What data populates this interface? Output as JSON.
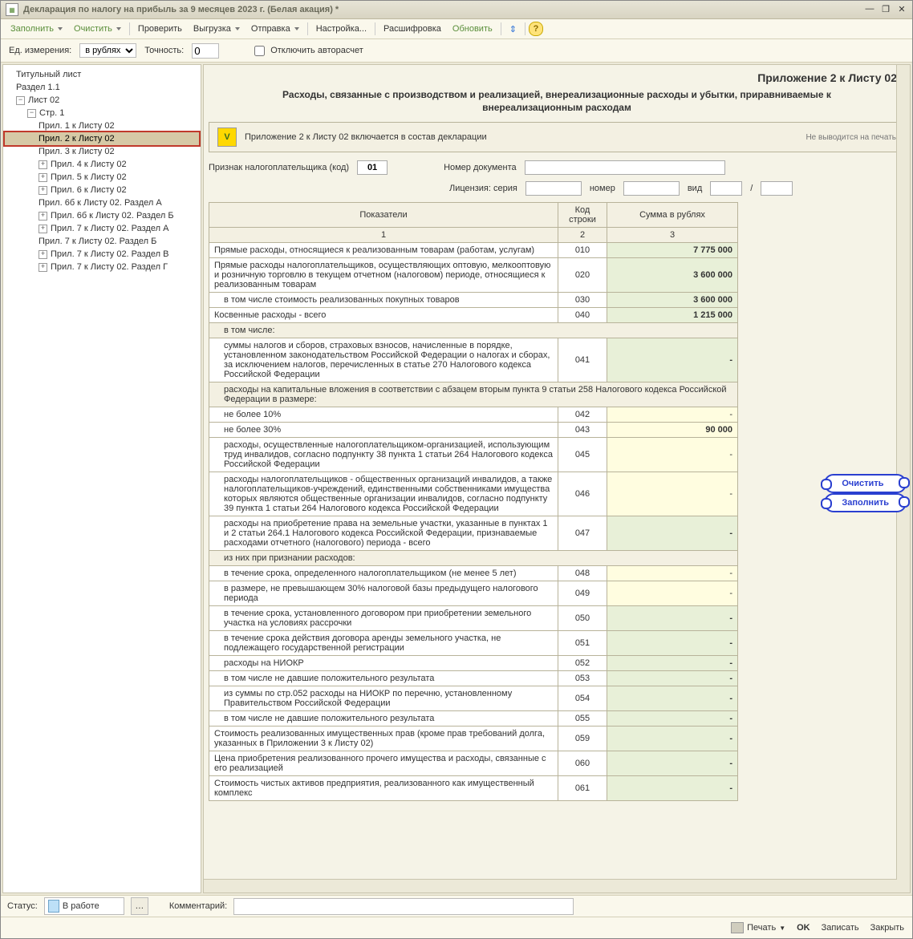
{
  "title": "Декларация по налогу на прибыль за 9 месяцев 2023 г. (Белая акация) *",
  "toolbar": {
    "fill": "Заполнить",
    "clear": "Очистить",
    "check": "Проверить",
    "upload": "Выгрузка",
    "send": "Отправка",
    "setup": "Настройка...",
    "decode": "Расшифровка",
    "refresh": "Обновить"
  },
  "opts": {
    "unit_label": "Ед. измерения:",
    "unit_value": "в рублях",
    "precision_label": "Точность:",
    "precision_value": "0",
    "autocalc": "Отключить авторасчет"
  },
  "tree": {
    "t1": "Титульный лист",
    "t2": "Раздел 1.1",
    "t3": "Лист 02",
    "t4": "Стр. 1",
    "i1": "Прил. 1 к Листу 02",
    "i2": "Прил. 2 к Листу 02",
    "i3": "Прил. 3 к Листу 02",
    "i4": "Прил. 4 к Листу 02",
    "i5": "Прил. 5 к Листу 02",
    "i6": "Прил. 6 к Листу 02",
    "i7": "Прил. 6б к Листу 02. Раздел А",
    "i8": "Прил. 6б к Листу 02. Раздел Б",
    "i9": "Прил. 7 к Листу 02. Раздел А",
    "i10": "Прил. 7 к Листу 02. Раздел Б",
    "i11": "Прил. 7 к Листу 02. Раздел В",
    "i12": "Прил. 7 к Листу 02. Раздел Г"
  },
  "page": {
    "title": "Приложение 2 к Листу 02",
    "subtitle": "Расходы, связанные с производством и реализацией, внереализационные расходы и убытки, приравниваемые к внереализационным расходам",
    "include_label": "Приложение 2 к Листу 02 включается в состав декларации",
    "noprint": "Не выводится на печать",
    "taxpayer_code_label": "Признак налогоплательщика (код)",
    "taxpayer_code": "01",
    "docnum_label": "Номер документа",
    "license_label": "Лицензия:  серия",
    "num_label": "номер",
    "type_label": "вид",
    "slash": "/"
  },
  "table": {
    "h1": "Показатели",
    "h2": "Код строки",
    "h3": "Сумма в рублях",
    "c1": "1",
    "c2": "2",
    "c3": "3",
    "rows": [
      {
        "t": "Прямые расходы, относящиеся к реализованным товарам (работам, услугам)",
        "c": "010",
        "s": "7 775 000",
        "cls": ""
      },
      {
        "t": "Прямые расходы налогоплательщиков, осуществляющих оптовую, мелкооптовую и розничную торговлю в текущем отчетном (налоговом) периоде, относящиеся к реализованным товарам",
        "c": "020",
        "s": "3 600 000",
        "cls": ""
      },
      {
        "t": "в том числе стоимость реализованных покупных товаров",
        "c": "030",
        "s": "3 600 000",
        "cls": "ind"
      },
      {
        "t": "Косвенные расходы - всего",
        "c": "040",
        "s": "1 215 000",
        "cls": ""
      },
      {
        "t": "в том числе:",
        "c": "",
        "s": "",
        "cls": "ind",
        "plain": true
      },
      {
        "t": "суммы налогов и сборов, страховых взносов, начисленные в порядке, установленном законодательством Российской Федерации о налогах и сборах, за исключением налогов, перечисленных в статье 270 Налогового кодекса Российской Федерации",
        "c": "041",
        "s": "-",
        "cls": "ind"
      },
      {
        "t": "расходы на капитальные вложения в соответствии с абзацем вторым пункта 9 статьи 258 Налогового кодекса Российской Федерации в размере:",
        "c": "",
        "s": "",
        "cls": "ind",
        "plain": true
      },
      {
        "t": "не более 10%",
        "c": "042",
        "s": "-",
        "cls": "ind",
        "yellow": true
      },
      {
        "t": "не более 30%",
        "c": "043",
        "s": "90 000",
        "cls": "ind",
        "yellow": true,
        "bold": true
      },
      {
        "t": "расходы, осуществленные налогоплательщиком-организацией, использующим труд инвалидов, согласно подпункту 38 пункта 1 статьи 264 Налогового кодекса Российской Федерации",
        "c": "045",
        "s": "-",
        "cls": "ind",
        "yellow": true
      },
      {
        "t": "расходы налогоплательщиков - общественных организаций инвалидов, а также налогоплательщиков-учреждений, единственными собственниками имущества которых являются общественные организации инвалидов, согласно подпункту 39 пункта 1 статьи 264 Налогового кодекса Российской Федерации",
        "c": "046",
        "s": "-",
        "cls": "ind",
        "yellow": true
      },
      {
        "t": "расходы на приобретение права на земельные участки, указанные в пунктах 1 и 2 статьи 264.1 Налогового кодекса Российской Федерации, признаваемые расходами отчетного (налогового) периода - всего",
        "c": "047",
        "s": "-",
        "cls": "ind"
      },
      {
        "t": "из них при признании расходов:",
        "c": "",
        "s": "",
        "cls": "ind",
        "plain": true
      },
      {
        "t": "в течение срока, определенного налогоплательщиком (не менее 5 лет)",
        "c": "048",
        "s": "-",
        "cls": "ind",
        "yellow": true
      },
      {
        "t": "в размере, не превышающем 30% налоговой базы предыдущего налогового периода",
        "c": "049",
        "s": "-",
        "cls": "ind",
        "yellow": true
      },
      {
        "t": "в течение срока, установленного договором при приобретении земельного участка на условиях рассрочки",
        "c": "050",
        "s": "-",
        "cls": "ind"
      },
      {
        "t": "в течение срока действия договора аренды земельного участка, не подлежащего государственной регистрации",
        "c": "051",
        "s": "-",
        "cls": "ind"
      },
      {
        "t": "расходы на НИОКР",
        "c": "052",
        "s": "-",
        "cls": "ind"
      },
      {
        "t": "в том числе не давшие положительного результата",
        "c": "053",
        "s": "-",
        "cls": "ind"
      },
      {
        "t": "из суммы по стр.052 расходы на НИОКР по перечню, установленному Правительством Российской Федерации",
        "c": "054",
        "s": "-",
        "cls": "ind"
      },
      {
        "t": "в том числе не давшие положительного результата",
        "c": "055",
        "s": "-",
        "cls": "ind"
      },
      {
        "t": "Стоимость реализованных имущественных прав (кроме прав требований долга, указанных в Приложении 3 к Листу 02)",
        "c": "059",
        "s": "-",
        "cls": ""
      },
      {
        "t": "Цена приобретения реализованного прочего имущества и расходы, связанные с его реализацией",
        "c": "060",
        "s": "-",
        "cls": ""
      },
      {
        "t": "Стоимость чистых активов предприятия, реализованного как имущественный комплекс",
        "c": "061",
        "s": "-",
        "cls": ""
      }
    ]
  },
  "bubbles": {
    "clear": "Очистить",
    "fill": "Заполнить"
  },
  "footer": {
    "status_label": "Статус:",
    "status_value": "В работе",
    "comment_label": "Комментарий:",
    "print": "Печать",
    "ok": "OK",
    "save": "Записать",
    "close": "Закрыть"
  }
}
